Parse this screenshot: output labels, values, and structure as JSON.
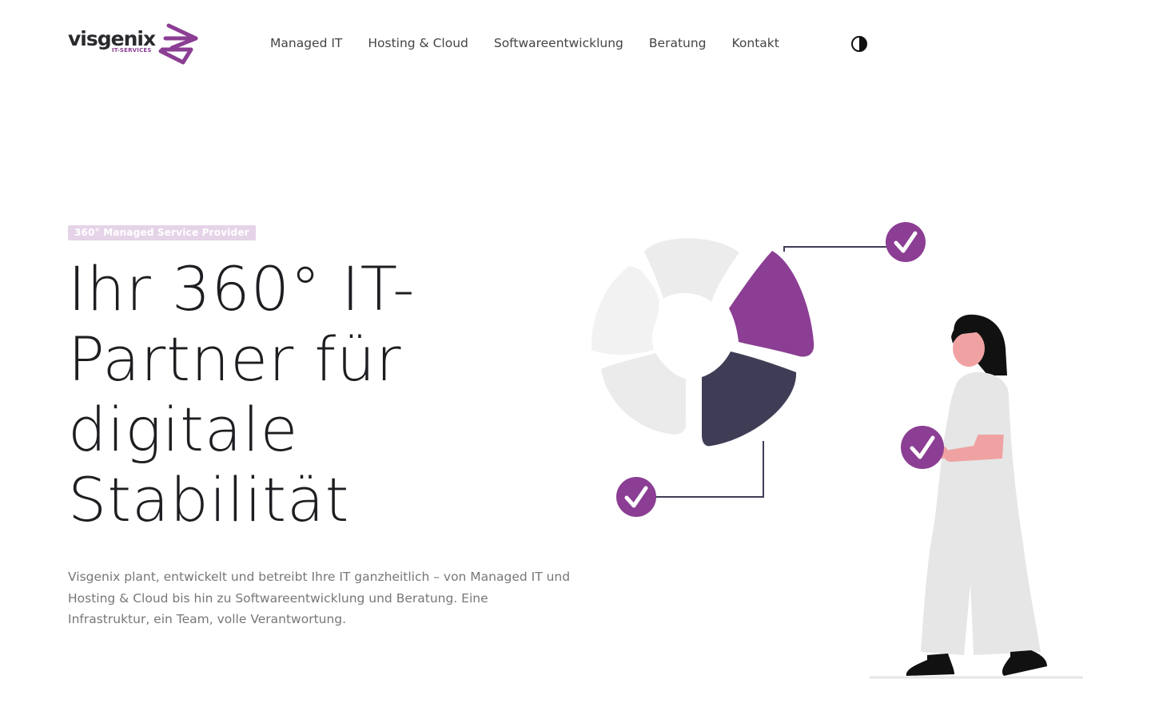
{
  "header": {
    "logo": {
      "wordmark": "visgenix",
      "subline": "IT-SERVICES"
    },
    "nav": [
      {
        "label": "Managed IT"
      },
      {
        "label": "Hosting & Cloud"
      },
      {
        "label": "Softwareentwicklung"
      },
      {
        "label": "Beratung"
      },
      {
        "label": "Kontakt"
      }
    ],
    "theme_toggle_icon": "contrast-icon"
  },
  "hero": {
    "badge": "360° Managed Service Provider",
    "title": "Ihr 360° IT-Partner für digitale Stabilität",
    "text": "Visgenix plant, entwickelt und betreibt Ihre IT ganzheitlich – von Managed IT und Hosting & Cloud bis hin zu Softwareentwicklung und Beratung. Eine Infrastruktur, ein Team, volle Verantwortung."
  },
  "colors": {
    "accent": "#8b3e93",
    "dark": "#3f3d56",
    "light_gray": "#e6e6e6",
    "skin": "#f0a2a2",
    "badge_bg": "#e5d3e8"
  }
}
